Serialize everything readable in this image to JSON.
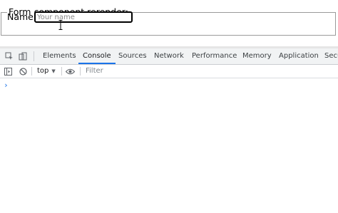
{
  "form": {
    "legend": "Form component rerender:",
    "name_label": "Name",
    "name_placeholder": "Your name",
    "name_value": ""
  },
  "devtools": {
    "tabs": [
      {
        "label": "Elements",
        "active": false
      },
      {
        "label": "Console",
        "active": true
      },
      {
        "label": "Sources",
        "active": false
      },
      {
        "label": "Network",
        "active": false
      },
      {
        "label": "Performance",
        "active": false
      },
      {
        "label": "Memory",
        "active": false
      },
      {
        "label": "Application",
        "active": false
      },
      {
        "label": "Secu",
        "active": false
      }
    ],
    "toolbar": {
      "context": "top",
      "filter_placeholder": "Filter"
    },
    "console_prompt": "›",
    "accent_color": "#1a73e8"
  }
}
